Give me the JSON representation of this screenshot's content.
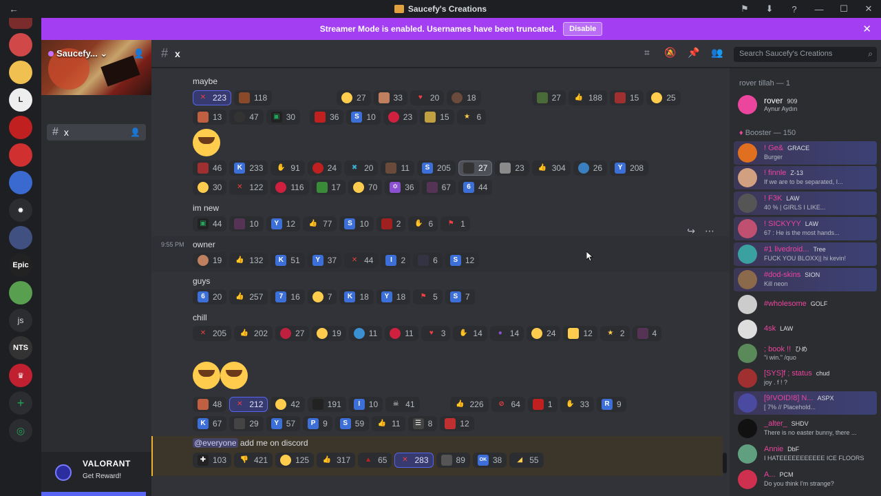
{
  "window": {
    "title": "Saucefy's Creations"
  },
  "rail": {
    "servers": [
      "js"
    ]
  },
  "banner": {
    "text": "Streamer Mode is enabled. Usernames have been truncated.",
    "button": "Disable"
  },
  "guild": {
    "name": "Saucefy...",
    "channel": "x"
  },
  "channel_header": {
    "name": "x"
  },
  "search": {
    "placeholder": "Search Saucefy's Creations"
  },
  "promo": {
    "name": "VALORANT",
    "action": "Get Reward!"
  },
  "messages": [
    {
      "text": "maybe"
    },
    {
      "text": "im new"
    },
    {
      "timestamp": "9:55 PM",
      "text": "owner"
    },
    {
      "text": "guys"
    },
    {
      "text": "chill"
    },
    {
      "mention": "@everyone",
      "text": " add me on discord"
    }
  ],
  "reactions": {
    "maybe_r1": [
      "223",
      "118",
      "27",
      "33",
      "20",
      "18",
      "27",
      "188",
      "15",
      "25"
    ],
    "maybe_r2": [
      "13",
      "47",
      "30",
      "36",
      "10",
      "23",
      "15",
      "6"
    ],
    "maybe_r3": [
      "46",
      "233",
      "91",
      "24",
      "20",
      "11",
      "205",
      "27",
      "23",
      "304",
      "26",
      "208"
    ],
    "maybe_r4": [
      "30",
      "122",
      "116",
      "17",
      "70",
      "36",
      "67",
      "44"
    ],
    "imnew": [
      "44",
      "10",
      "12",
      "77",
      "10",
      "2",
      "6",
      "1"
    ],
    "owner": [
      "19",
      "132",
      "51",
      "37",
      "44",
      "2",
      "6",
      "12"
    ],
    "guys": [
      "20",
      "257",
      "16",
      "7",
      "18",
      "18",
      "5",
      "7"
    ],
    "chill_r1": [
      "205",
      "202",
      "27",
      "19",
      "11",
      "11",
      "3",
      "14",
      "14",
      "24",
      "12",
      "2",
      "4"
    ],
    "chill_r2": [
      "48",
      "212",
      "42",
      "191",
      "10",
      "41",
      "226",
      "64",
      "1",
      "33",
      "9"
    ],
    "chill_r3": [
      "67",
      "29",
      "57",
      "9",
      "59",
      "11",
      "8",
      "12"
    ],
    "everyone": [
      "103",
      "421",
      "125",
      "317",
      "65",
      "283",
      "89",
      "38",
      "55"
    ]
  },
  "members": {
    "groups": [
      {
        "label": "rover tillah — 1"
      },
      {
        "label": "Booster — 150"
      }
    ],
    "list": [
      {
        "name": "rover",
        "tag": "909",
        "status": "Aynur Aydın"
      },
      {
        "name": "! Ge&",
        "tag": "GRACE",
        "status": "Burger"
      },
      {
        "name": "! finnle",
        "tag": "Z-13",
        "status": "If we are to be separated, I..."
      },
      {
        "name": "! F3K",
        "tag": "LAW",
        "status": "40 % | GIRLS I LIKE..."
      },
      {
        "name": "! SICKYYY",
        "tag": "LAW",
        "status": "67 : He is the most hands..."
      },
      {
        "name": "#1 livedroid...",
        "tag": "Tree",
        "status": "FUCK YOU BLOXX|| hi kevin!"
      },
      {
        "name": "#dod-skins",
        "tag": "SION",
        "status": "Kill neon"
      },
      {
        "name": "#wholesome",
        "tag": "GOLF",
        "status": ""
      },
      {
        "name": "4sk",
        "tag": "LAW",
        "status": ""
      },
      {
        "name": "; book !!",
        "tag": "ひめ",
        "status": "\"i win.\" /quo"
      },
      {
        "name": "[SYS]f ; status",
        "tag": "chud",
        "status": "joy . f ! ?"
      },
      {
        "name": "[9!VOID!8] N...",
        "tag": "ASPX",
        "status": "[ 7% // Placehold..."
      },
      {
        "name": "_alter_",
        "tag": "SHDV",
        "status": "There is no easter bunny, there ..."
      },
      {
        "name": "Annie",
        "tag": "DbF",
        "status": "I HATEEEEEEEEEEE ICE FLOORS"
      },
      {
        "name": "A...",
        "tag": "PCM",
        "status": "Do you think I'm strange?"
      }
    ]
  },
  "colors": {
    "accent": "#5865f2",
    "banner": "#a33ef2",
    "mention": "#f0b232"
  }
}
